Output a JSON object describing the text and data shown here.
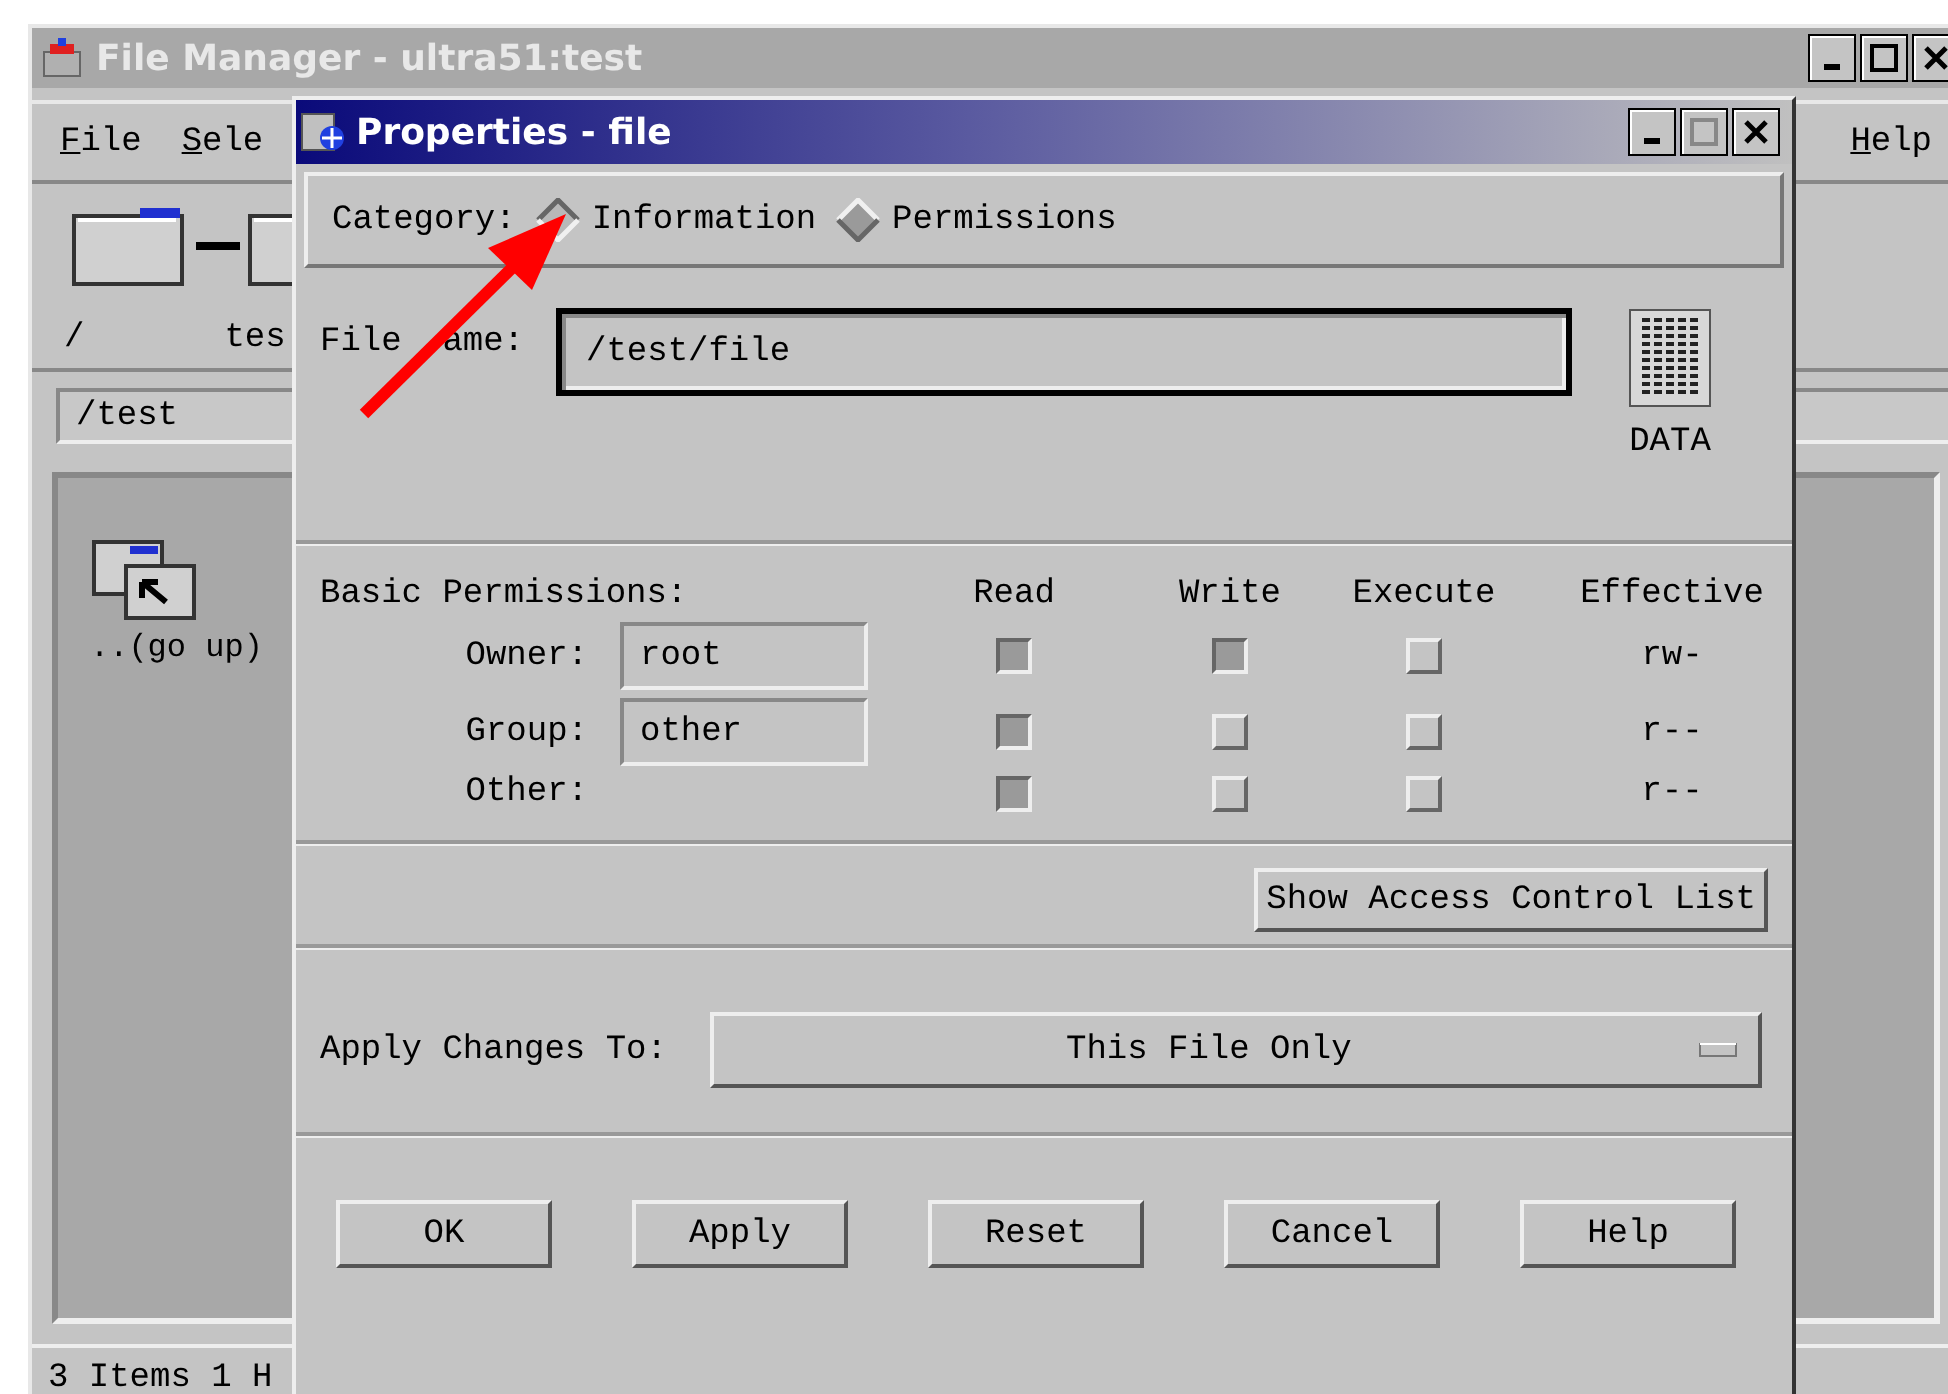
{
  "file_manager": {
    "title": "File Manager - ultra51:test",
    "menus": [
      {
        "label": "File"
      },
      {
        "label": "Sele"
      }
    ],
    "right_menus": [
      {
        "label": "Help"
      }
    ],
    "path_segments": [
      "/",
      "tes"
    ],
    "path_field": "/test",
    "items": [
      {
        "label": "..(go up)"
      }
    ],
    "status": "3 Items 1 H"
  },
  "dialog": {
    "title": "Properties - file",
    "category_label": "Category:",
    "categories": [
      {
        "label": "Information",
        "selected": true
      },
      {
        "label": "Permissions",
        "selected": false
      }
    ],
    "file_name_label": [
      "File",
      "ame:"
    ],
    "file_name": "/test/file",
    "file_type": "DATA",
    "permissions_label": "Basic Permissions:",
    "columns": [
      "Read",
      "Write",
      "Execute",
      "Effective"
    ],
    "rows": [
      {
        "label": "Owner:",
        "value": "root",
        "read": true,
        "write": true,
        "execute": false,
        "effective": "rw-"
      },
      {
        "label": "Group:",
        "value": "other",
        "read": true,
        "write": false,
        "execute": false,
        "effective": "r--"
      },
      {
        "label": "Other:",
        "read": true,
        "write": false,
        "execute": false,
        "effective": "r--"
      }
    ],
    "acl_button": "Show Access Control List",
    "apply_label": "Apply Changes To:",
    "apply_value": "This File Only",
    "buttons": [
      "OK",
      "Apply",
      "Reset",
      "Cancel",
      "Help"
    ]
  }
}
